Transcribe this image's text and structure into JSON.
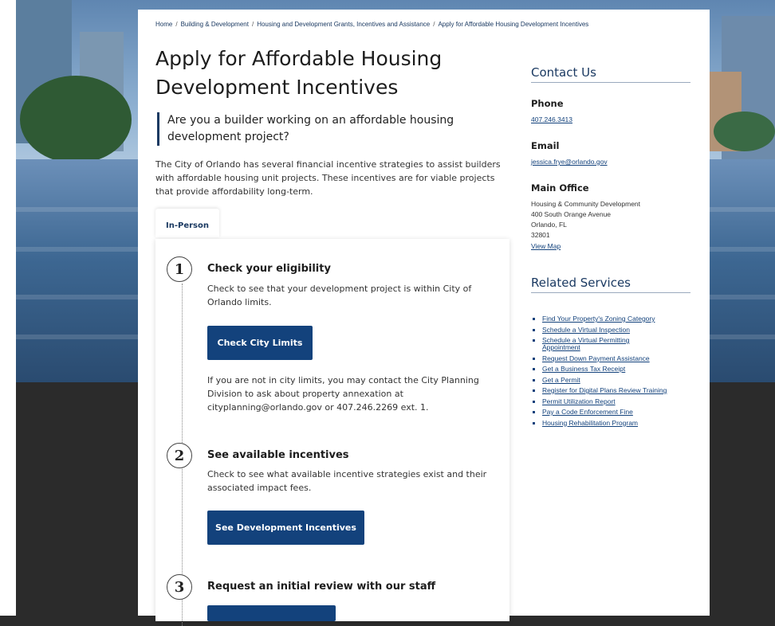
{
  "breadcrumb": {
    "items": [
      "Home",
      "Building & Development",
      "Housing and Development Grants, Incentives and Assistance",
      "Apply for Affordable Housing Development Incentives"
    ]
  },
  "page": {
    "title": "Apply for Affordable Housing Development Incentives",
    "question": "Are you a builder working on an affordable housing development project?",
    "intro": "The City of Orlando has several financial incentive strategies to assist builders with affordable housing unit projects. These incentives are for viable projects that provide affordability long-term."
  },
  "tabs": [
    {
      "label": "In-Person"
    }
  ],
  "steps": [
    {
      "number": "1",
      "title": "Check your eligibility",
      "text": "Check to see that your development project is within City of Orlando limits.",
      "button": "Check City Limits",
      "note": "If you are not in city limits, you may contact the City Planning Division to ask about property annexation at cityplanning@orlando.gov or 407.246.2269 ext. 1."
    },
    {
      "number": "2",
      "title": "See available incentives",
      "text": "Check to see what available incentive strategies exist and their associated impact fees.",
      "button": "See Development Incentives"
    },
    {
      "number": "3",
      "title": "Request an initial review with our staff"
    }
  ],
  "contact": {
    "heading": "Contact Us",
    "phone_label": "Phone",
    "phone": "407.246.3413",
    "email_label": "Email",
    "email": "jessica.frye@orlando.gov",
    "office_label": "Main Office",
    "office_lines": [
      "Housing & Community Development",
      "400 South Orange Avenue",
      "Orlando, FL",
      "32801"
    ],
    "map_link": "View Map"
  },
  "related": {
    "heading": "Related Services",
    "items": [
      "Find Your Property's Zoning Category",
      "Schedule a Virtual Inspection",
      "Schedule a Virtual Permitting Appointment",
      "Request Down Payment Assistance",
      "Get a Business Tax Receipt",
      "Get a Permit",
      "Register for Digital Plans Review Training",
      "Permit Utilization Report",
      "Pay a Code Enforcement Fine",
      "Housing Rehabilitation Program"
    ]
  },
  "colors": {
    "brand": "#13427c",
    "heading": "#1b3a62"
  }
}
